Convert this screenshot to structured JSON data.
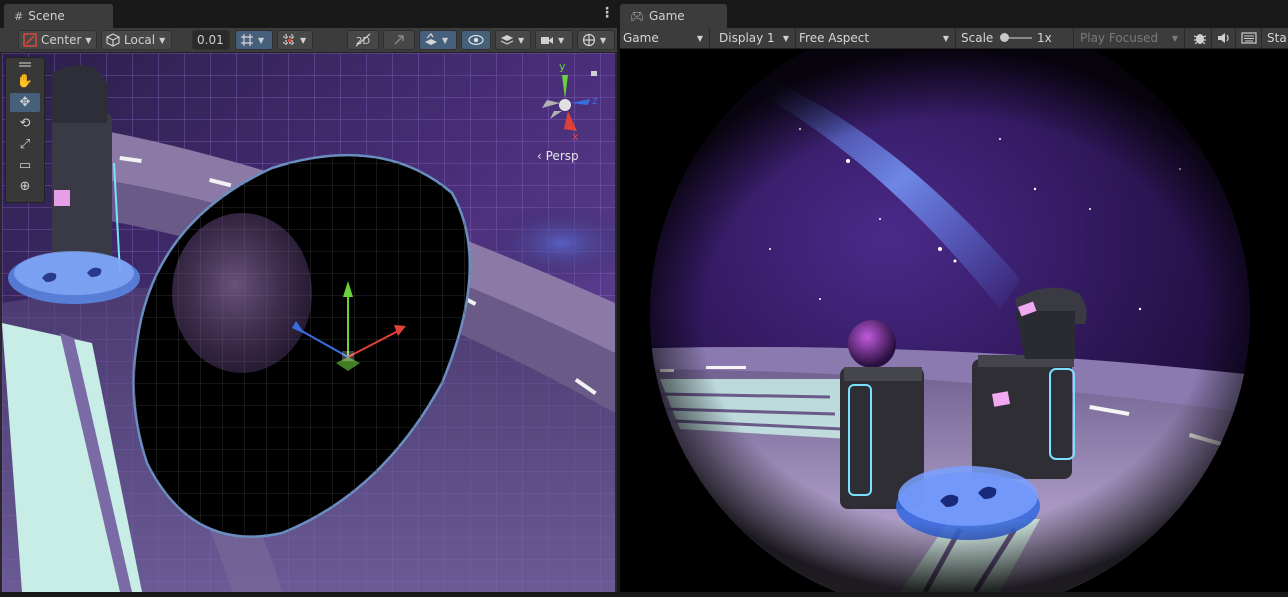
{
  "scene": {
    "tab_label": "Scene",
    "pivot_mode": "Center",
    "pivot_rotation": "Local",
    "snap_value": "0.01",
    "gizmo": {
      "x_label": "x",
      "y_label": "y",
      "z_label": "z",
      "projection_label": "Persp"
    },
    "tools": [
      "hand-tool",
      "move-tool",
      "rotate-tool",
      "scale-tool",
      "rect-tool",
      "transform-tool"
    ]
  },
  "game": {
    "tab_label": "Game",
    "view_mode": "Game",
    "display": "Display 1",
    "aspect": "Free Aspect",
    "scale_label": "Scale",
    "scale_value": "1x",
    "play_mode": "Play Focused",
    "stats_label": "Sta"
  },
  "colors": {
    "accent": "#46607c",
    "panel": "#282828",
    "toolbar": "#3c3c3c",
    "gizmo_x": "#e0403a",
    "gizmo_y": "#6ad13a",
    "gizmo_z": "#3a6ee0"
  }
}
